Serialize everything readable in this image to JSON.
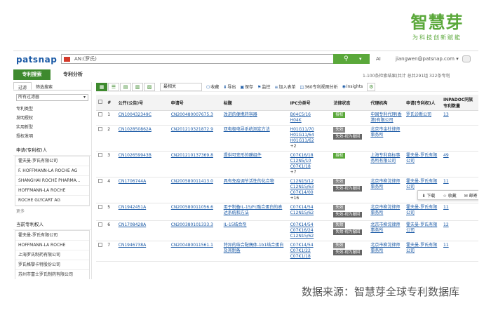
{
  "brand": {
    "logo": "智慧芽",
    "tagline": "为科技创新赋能"
  },
  "app": {
    "logo": "patsnap",
    "search_value": "AN:(罗氏)",
    "ai_label": "AI",
    "user": "jiangwen@patsnap.com ▾"
  },
  "tabs": [
    "专利搜索",
    "专利分析"
  ],
  "stats": "1-100条检索结果(共计 总共291组 322条专利",
  "side": {
    "subtabs": [
      "过滤",
      "筛选搜索"
    ],
    "select": "所有过滤器",
    "filters": [
      "专利类型",
      "发明授权",
      "实用新型",
      "授权发明"
    ],
    "applicant_title": "申请(专利权)人",
    "applicants": [
      "霍夫曼-罗氏有限公司",
      "F. HOFFMANN-LA ROCHE AG",
      "SHANGHAI ROCHE PHARMA...",
      "HOFFMANN-LA ROCHE",
      "ROCHE GLYCART AG"
    ],
    "more1": "更多",
    "owner_title": "当前专利权人",
    "owners": [
      "霍夫曼-罗氏有限公司",
      "HOFFMANN-LA ROCHE",
      "上海罗氏制药有限公司",
      "罗氏格黎卡特股份公司",
      "苏州市富士罗氏制药有限公司"
    ]
  },
  "toolbar": {
    "views": [
      "▦",
      "☰",
      "▤",
      "▥",
      "▨"
    ],
    "sort": "最相关",
    "actions": [
      {
        "icon": "⬡",
        "label": "收藏"
      },
      {
        "icon": "⬇",
        "label": "导出"
      },
      {
        "icon": "▣",
        "label": "保存"
      },
      {
        "icon": "⚑",
        "label": "监控"
      },
      {
        "icon": "≡",
        "label": "加入表单"
      },
      {
        "icon": "◫",
        "label": "360专利视图分析"
      },
      {
        "icon": "◉",
        "label": "Insights"
      }
    ],
    "gear": "⚙"
  },
  "table": {
    "headers": [
      "",
      "#",
      "公开(公告)号",
      "申请号",
      "标题",
      "IPC分类号",
      "法律状态",
      "代理机构",
      "申请(专利权)人",
      "INPADOC同族专利数量"
    ],
    "rows": [
      {
        "n": "1",
        "pub": "CN100432349C",
        "app": "CN200480007675.3",
        "title": "改进的便携药容器",
        "ipc": [
          "B04C5/16",
          "H04K"
        ],
        "ipc_more": "",
        "status": [
          [
            "授权",
            "g"
          ]
        ],
        "agent": "中国专利代理(香港)有限公司",
        "owner": "罗氏诊断公司",
        "family": "13"
      },
      {
        "n": "2",
        "pub": "CN102850862A",
        "app": "CN201210321872.9",
        "title": "双电极电导系统测定方法",
        "ipc": [
          "H01G11/70",
          "H01G11/64",
          "H01G11/62"
        ],
        "ipc_more": "+2",
        "status": [
          [
            "失效",
            "gr"
          ],
          [
            "失效-视为撤回",
            "dk"
          ]
        ],
        "agent": "北京市金杜律师事务所",
        "owner": "",
        "family": ""
      },
      {
        "n": "3",
        "pub": "CN102659943B",
        "app": "CN201210137369.8",
        "title": "提供可变形的膜组件",
        "ipc": [
          "C07K16/18",
          "C12N5/10",
          "C07K1/18"
        ],
        "ipc_more": "+7",
        "status": [
          [
            "授权",
            "g"
          ]
        ],
        "agent": "上海专利商标事务所有限公司",
        "owner": "霍夫曼-罗氏有限公司",
        "family": "49"
      },
      {
        "n": "4",
        "pub": "CN1706744A",
        "app": "CN200580011413.0",
        "title": "具有免疫调节活性的化合物",
        "ipc": [
          "C12N15/12",
          "C12N15/63",
          "C07K14/00"
        ],
        "ipc_more": "+16",
        "status": [
          [
            "失效",
            "gr"
          ],
          [
            "失效-视为撤回",
            "dk"
          ]
        ],
        "agent": "北京市柳沈律师事务所",
        "owner": "霍夫曼-罗氏有限公司",
        "family": "11"
      },
      {
        "n": "5",
        "pub": "CN1942451A",
        "app": "CN200580011056.6",
        "title": "用于制备IL-15/Fc融合蛋白的表达系统和方法",
        "ipc": [
          "C07K14/54",
          "C12N15/62"
        ],
        "ipc_more": "",
        "status": [
          [
            "失效",
            "gr"
          ],
          [
            "失效-视为撤回",
            "dk"
          ]
        ],
        "agent": "北京市柳沈律师事务所",
        "owner": "霍夫曼-罗氏有限公司",
        "family": "11"
      },
      {
        "n": "6",
        "pub": "CN1708428A",
        "app": "CN200380101333.3",
        "title": "IL-15结合剂",
        "ipc": [
          "C07K14/54",
          "C07K16/24",
          "C12N15/62"
        ],
        "ipc_more": "",
        "status": [
          [
            "失效",
            "gr"
          ],
          [
            "失效-视为撤回",
            "dk"
          ]
        ],
        "agent": "北京市柳沈律师事务所",
        "owner": "霍夫曼-罗氏有限公司",
        "family": "12"
      },
      {
        "n": "7",
        "pub": "CN1946738A",
        "app": "CN200480011561.1",
        "title": "特异的结合配偶体-1b1结合蛋白及其制备",
        "ipc": [
          "C07K14/54",
          "C07K1/22",
          "C07K1/18"
        ],
        "ipc_more": "",
        "status": [
          [
            "失效",
            "gr"
          ],
          [
            "失效-视为撤回",
            "dk"
          ]
        ],
        "agent": "北京市柳沈律师事务所",
        "owner": "霍夫曼-罗氏有限公司",
        "family": "11"
      }
    ]
  },
  "popup": {
    "items": [
      "⬇ 下载",
      "☆ 收藏",
      "✉ 邮寄"
    ]
  },
  "caption": "数据来源：智慧芽全球专利数据库"
}
